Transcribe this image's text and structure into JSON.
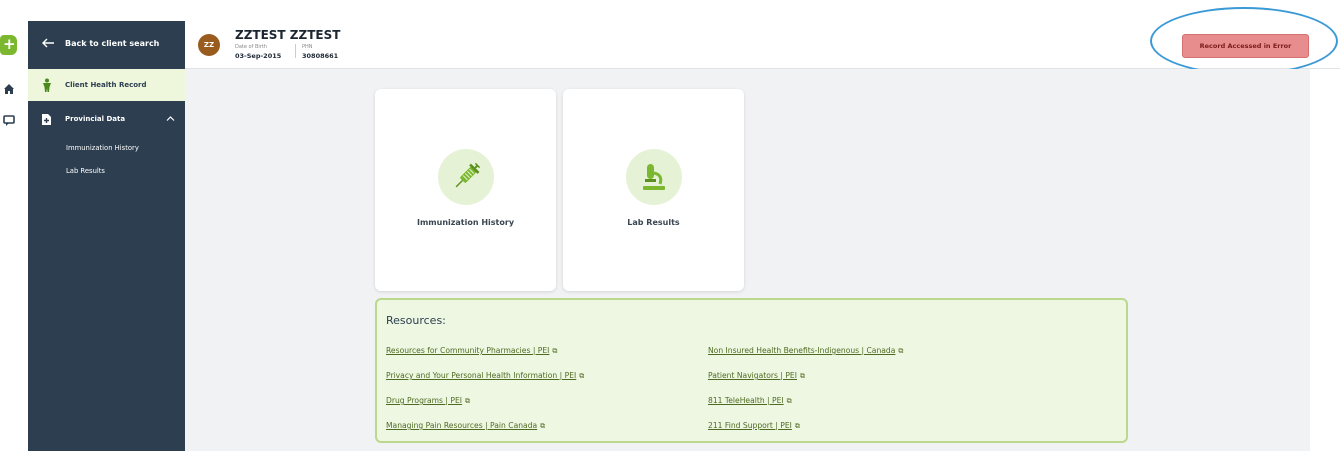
{
  "sidebar": {
    "back_label": "Back to client search",
    "client_health_record": "Client Health Record",
    "provincial_data": "Provincial Data",
    "sub_items": [
      "Immunization History",
      "Lab Results"
    ]
  },
  "header": {
    "avatar_initials": "ZZ",
    "patient_name": "ZZTEST ZZTEST",
    "dob_label": "Date of Birth",
    "dob_value": "03-Sep-2015",
    "phn_label": "PHN",
    "phn_value": "30808661",
    "record_error_button": "Record Accessed in Error"
  },
  "cards": [
    {
      "label": "Immunization History",
      "icon": "syringe-icon"
    },
    {
      "label": "Lab Results",
      "icon": "microscope-icon"
    }
  ],
  "resources": {
    "title": "Resources:",
    "left_links": [
      "Resources for Community Pharmacies | PEI",
      "Privacy and Your Personal Health Information | PEI",
      "Drug Programs | PEI",
      "Managing Pain Resources | Pain Canada"
    ],
    "right_links": [
      "Non Insured Health Benefits-Indigenous | Canada",
      "Patient Navigators | PEI",
      "811 TeleHealth | PEI",
      "211 Find Support | PEI"
    ],
    "external_glyph": "⧉"
  },
  "colors": {
    "sidebar_bg": "#2c3e50",
    "accent_green": "#7cb82f",
    "error_button": "#e88d8d",
    "highlight_ring": "#3b9ad6"
  }
}
